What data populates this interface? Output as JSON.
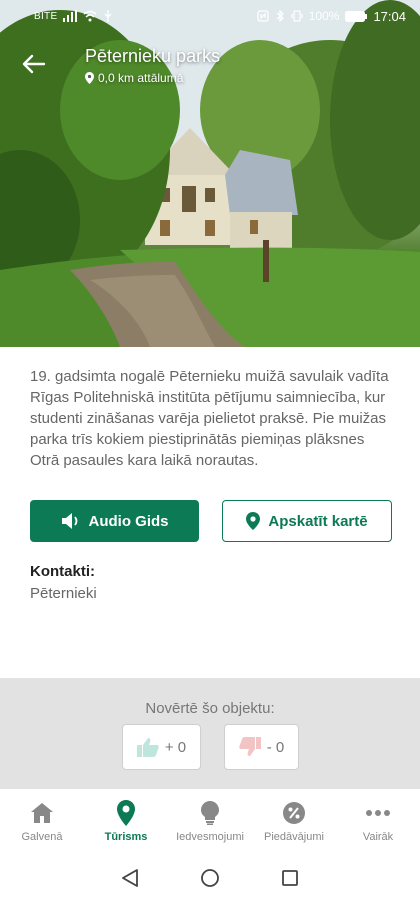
{
  "status_bar": {
    "carrier": "BITE",
    "battery": "100%",
    "time": "17:04"
  },
  "header": {
    "title": "Pēternieku parks",
    "distance": "0,0 km attālumā"
  },
  "description": "19. gadsimta nogalē Pēternieku muižā savulaik vadīta Rīgas Politehniskā institūta pētījumu saimniecība, kur studenti zināšanas varēja pielietot praksē. Pie muižas parka trīs kokiem piestiprinātās piemiņas plāksnes Otrā pasaules kara laikā norautas.",
  "buttons": {
    "audio": "Audio Gids",
    "map": "Apskatīt kartē"
  },
  "contacts": {
    "title": "Kontakti:",
    "value": "Pēternieki"
  },
  "rating": {
    "label": "Novērtē šo objektu:",
    "up": "+ 0",
    "down": "- 0"
  },
  "bottom_nav": {
    "items": [
      {
        "label": "Galvenā",
        "icon": "home-icon",
        "active": false
      },
      {
        "label": "Tūrisms",
        "icon": "location-pin-icon",
        "active": true
      },
      {
        "label": "Iedvesmojumi",
        "icon": "lightbulb-icon",
        "active": false
      },
      {
        "label": "Piedāvājumi",
        "icon": "percent-badge-icon",
        "active": false
      },
      {
        "label": "Vairāk",
        "icon": "more-dots-icon",
        "active": false
      }
    ]
  },
  "colors": {
    "accent": "#0c7a55",
    "rating_bg": "#e2e2e2"
  }
}
